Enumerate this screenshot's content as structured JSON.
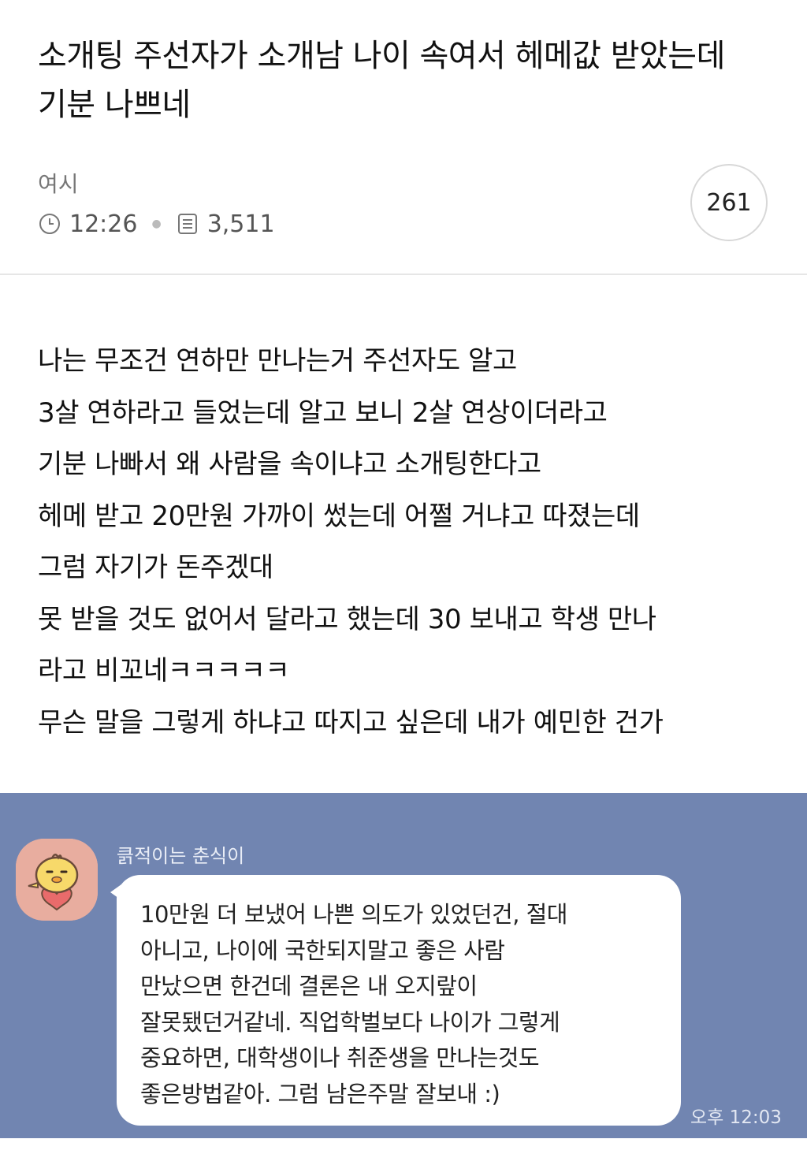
{
  "post": {
    "title": "소개팅 주선자가 소개남 나이 속여서 헤메값 받았는데 기분 나쁘네",
    "author": "여시",
    "time": "12:26",
    "views": "3,511",
    "comment_count": "261",
    "icons": {
      "time": "clock-icon",
      "views": "document-icon"
    }
  },
  "body_lines": [
    "나는 무조건 연하만 만나는거 주선자도 알고",
    "3살 연하라고 들었는데 알고 보니 2살 연상이더라고",
    "기분 나빠서 왜 사람을 속이냐고 소개팅한다고",
    "헤메 받고 20만원 가까이 썼는데 어쩔 거냐고 따졌는데",
    "그럼 자기가 돈주겠대",
    "못 받을 것도 없어서 달라고 했는데 30 보내고 학생 만나",
    "라고 비꼬네ㅋㅋㅋㅋㅋ",
    "무슨 말을 그렇게 하냐고 따지고 싶은데 내가 예민한 건가"
  ],
  "chat": {
    "sender": "큵적이는 춘식이",
    "message_lines": [
      "10만원 더 보냈어 나쁜 의도가 있었던건, 절대",
      "아니고, 나이에 국한되지말고 좋은 사람",
      "만났으면 한건데 결론은 내 오지랖이",
      "잘못됐던거같네. 직업학벌보다 나이가 그렇게",
      "중요하면, 대학생이나 취준생을 만나는것도",
      "좋은방법같아. 그럼 남은주말 잘보내 :)"
    ],
    "time": "오후 12:03",
    "background_color": "#7185b1",
    "avatar_icon": "chick-avatar-icon"
  }
}
